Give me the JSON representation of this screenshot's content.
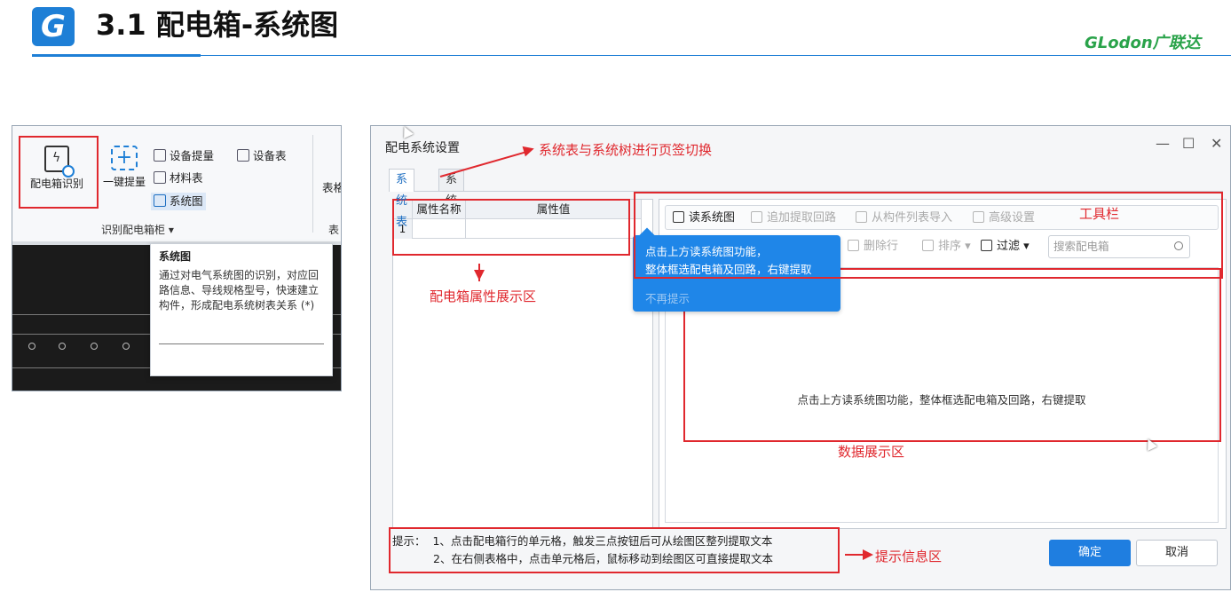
{
  "slide": {
    "logo_letter": "G",
    "title": "3.1 配电箱-系统图",
    "brand": "GLodon广联达"
  },
  "ribbon": {
    "btn_identify": "配电箱识别",
    "btn_one_key": "一键提量",
    "btn_equipment_extract": "设备提量",
    "btn_equipment_table": "设备表",
    "btn_material_table": "材料表",
    "btn_system_diagram": "系统图",
    "btn_table_partial": "表格",
    "group_label": "识别配电箱柜 ▾",
    "group_label2": "表",
    "tooltip": {
      "title": "系统图",
      "body": "通过对电气系统图的识别，对应回路信息、导线规格型号，快速建立构件，形成配电系统树表关系 (*)"
    }
  },
  "dialog": {
    "title": "配电系统设置",
    "minimize": "—",
    "maximize": "☐",
    "close": "✕",
    "tabs": [
      "系统表",
      "系统树"
    ],
    "grid": {
      "col_name": "属性名称",
      "col_value": "属性值",
      "row_index": "1"
    },
    "toolbar1": {
      "read_diagram": "读系统图",
      "add_circuit": "追加提取回路",
      "import_from_list": "从构件列表导入",
      "advanced": "高级设置"
    },
    "toolbar2": {
      "delete_row": "删除行",
      "sort": "排序 ▾",
      "filter": "过滤 ▾",
      "search_placeholder": "搜索配电箱"
    },
    "blue_tip": {
      "line1": "点击上方读系统图功能，",
      "line2": "整体框选配电箱及回路，右键提取",
      "no_more": "不再提示"
    },
    "center_hint": "点击上方读系统图功能，整体框选配电箱及回路，右键提取",
    "bottom_hint": {
      "label": "提示：",
      "line1": "1、点击配电箱行的单元格，触发三点按钮后可从绘图区整列提取文本",
      "line2": "2、在右侧表格中，点击单元格后，鼠标移动到绘图区可直接提取文本"
    },
    "ok": "确定",
    "cancel": "取消"
  },
  "annotations": {
    "tab_switch": "系统表与系统树进行页签切换",
    "toolbar": "工具栏",
    "property_area": "配电箱属性展示区",
    "data_area": "数据展示区",
    "hint_area": "提示信息区"
  },
  "colors": {
    "accent_blue": "#1e7fd6",
    "annotation_red": "#e0282e",
    "brand_green": "#2aa34a"
  }
}
